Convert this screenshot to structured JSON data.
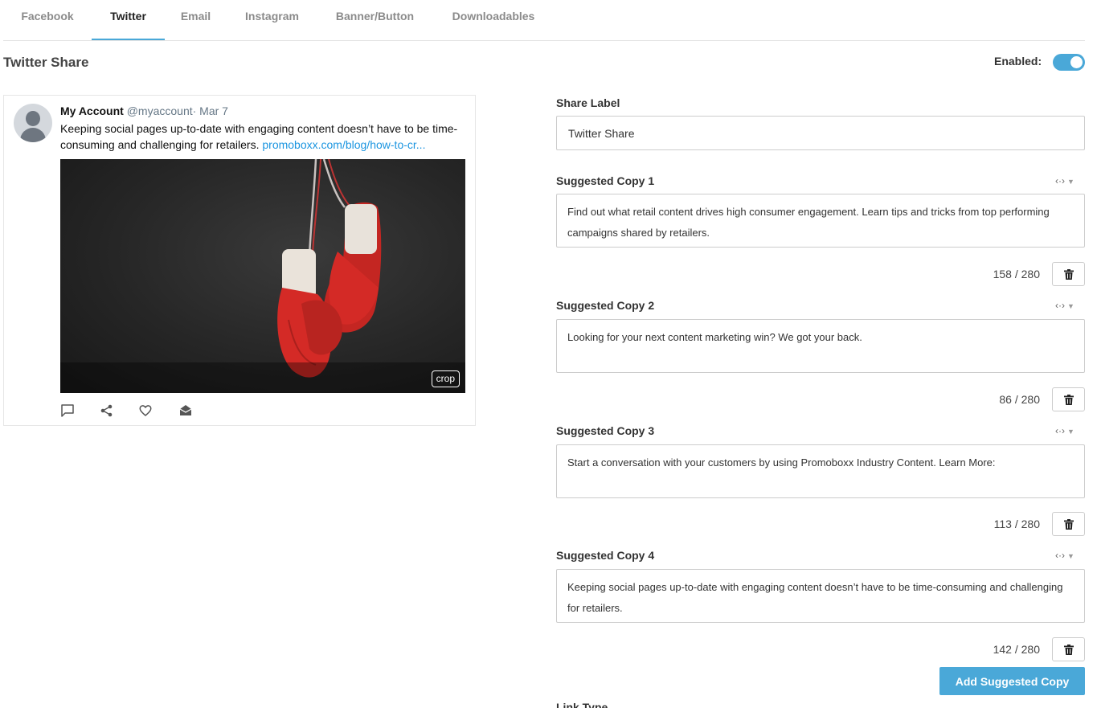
{
  "tabs": [
    {
      "label": "Facebook"
    },
    {
      "label": "Twitter"
    },
    {
      "label": "Email"
    },
    {
      "label": "Instagram"
    },
    {
      "label": "Banner/Button"
    },
    {
      "label": "Downloadables"
    }
  ],
  "active_tab": "Twitter",
  "section_title": "Twitter Share",
  "enabled": {
    "label": "Enabled:",
    "value": true
  },
  "tweet": {
    "name": "My Account",
    "handle_date": "@myaccount· Mar 7",
    "text": "Keeping social pages up-to-date with engaging content doesn’t have to be time-consuming and challenging for retailers.",
    "link": "promoboxx.com/blog/how-to-cr...",
    "crop_label": "crop",
    "actions": [
      "comment-icon",
      "share-icon",
      "heart-icon",
      "envelope-icon"
    ]
  },
  "share_label": {
    "label": "Share Label",
    "value": "Twitter Share"
  },
  "code_toggle_label": "‹·›",
  "copies": [
    {
      "label": "Suggested Copy 1",
      "text": "Find out what retail content drives high consumer engagement. Learn tips and tricks from top performing campaigns shared by retailers.",
      "counter": "158 / 280"
    },
    {
      "label": "Suggested Copy 2",
      "text": "Looking for your next content marketing win? We got your back.",
      "counter": "86 / 280"
    },
    {
      "label": "Suggested Copy 3",
      "text": "Start a conversation with your customers by using Promoboxx Industry Content. Learn More:",
      "counter": "113 / 280"
    },
    {
      "label": "Suggested Copy 4",
      "text": "Keeping social pages up-to-date with engaging content doesn’t have to be time-consuming and challenging for retailers.",
      "counter": "142 / 280"
    }
  ],
  "add_button_label": "Add Suggested Copy",
  "link_type_label": "Link Type",
  "colors": {
    "accent": "#4aa8d8",
    "link": "#1b95e0",
    "glove_red": "#d42a26"
  }
}
